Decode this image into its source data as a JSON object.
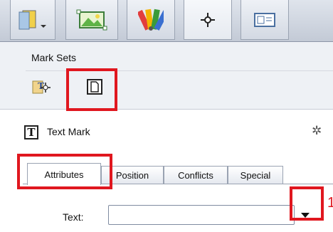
{
  "toolbar": {
    "buttons": [
      {
        "icon": "book-panel-icon"
      },
      {
        "icon": "image-icon"
      },
      {
        "icon": "color-swatches-icon"
      },
      {
        "icon": "crosshair-icon"
      },
      {
        "icon": "card-layout-icon"
      }
    ]
  },
  "mark_sets": {
    "title": "Mark Sets",
    "tools": [
      {
        "icon": "text-mark-tool-icon"
      },
      {
        "icon": "new-page-icon"
      }
    ]
  },
  "text_mark": {
    "icon_glyph": "T",
    "label": "Text Mark",
    "gear_glyph": "✲",
    "tabs": [
      "Attributes",
      "Position",
      "Conflicts",
      "Special"
    ],
    "selected_tab": "Attributes",
    "text_field": {
      "label": "Text:",
      "value": "",
      "placeholder": ""
    }
  },
  "annotations": {
    "number": "1",
    "color": "#e0171f"
  }
}
